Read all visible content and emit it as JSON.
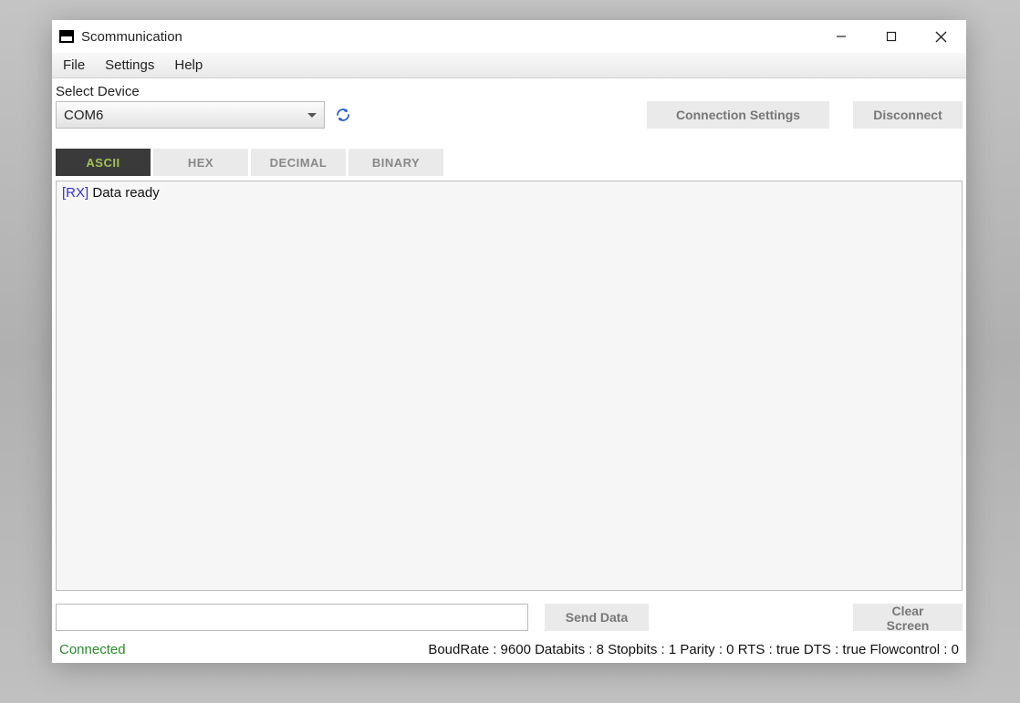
{
  "window": {
    "title": "Scommunication"
  },
  "menu": {
    "file": "File",
    "settings": "Settings",
    "help": "Help"
  },
  "device": {
    "label": "Select Device",
    "selected": "COM6"
  },
  "buttons": {
    "connection_settings": "Connection Settings",
    "disconnect": "Disconnect",
    "send_data": "Send Data",
    "clear_screen": "Clear Screen"
  },
  "tabs": [
    {
      "label": "ASCII",
      "active": true
    },
    {
      "label": "HEX",
      "active": false
    },
    {
      "label": "DECIMAL",
      "active": false
    },
    {
      "label": "BINARY",
      "active": false
    }
  ],
  "terminal": {
    "lines": [
      {
        "prefix": "[RX]",
        "text": " Data ready"
      }
    ]
  },
  "send": {
    "value": "",
    "placeholder": ""
  },
  "status": {
    "connected": "Connected",
    "details": "BoudRate : 9600 Databits : 8 Stopbits : 1 Parity : 0 RTS : true DTS : true Flowcontrol : 0"
  }
}
